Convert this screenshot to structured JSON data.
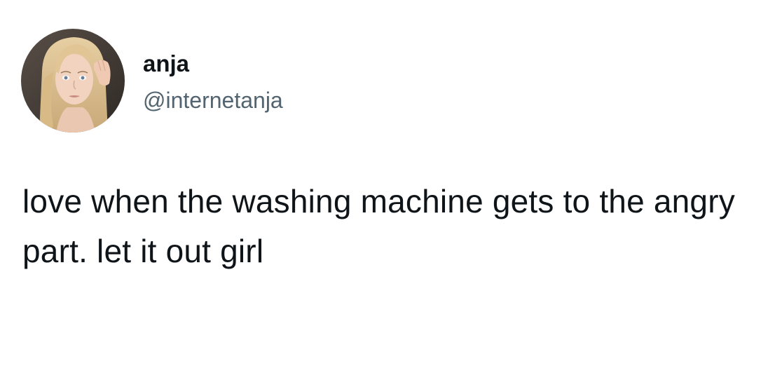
{
  "tweet": {
    "author": {
      "display_name": "anja",
      "handle": "@internetanja",
      "avatar_icon": "profile-photo"
    },
    "text": "love when the washing machine gets to the angry part. let it out girl"
  },
  "colors": {
    "background": "#ffffff",
    "text_primary": "#0f1419",
    "text_secondary": "#536471"
  }
}
